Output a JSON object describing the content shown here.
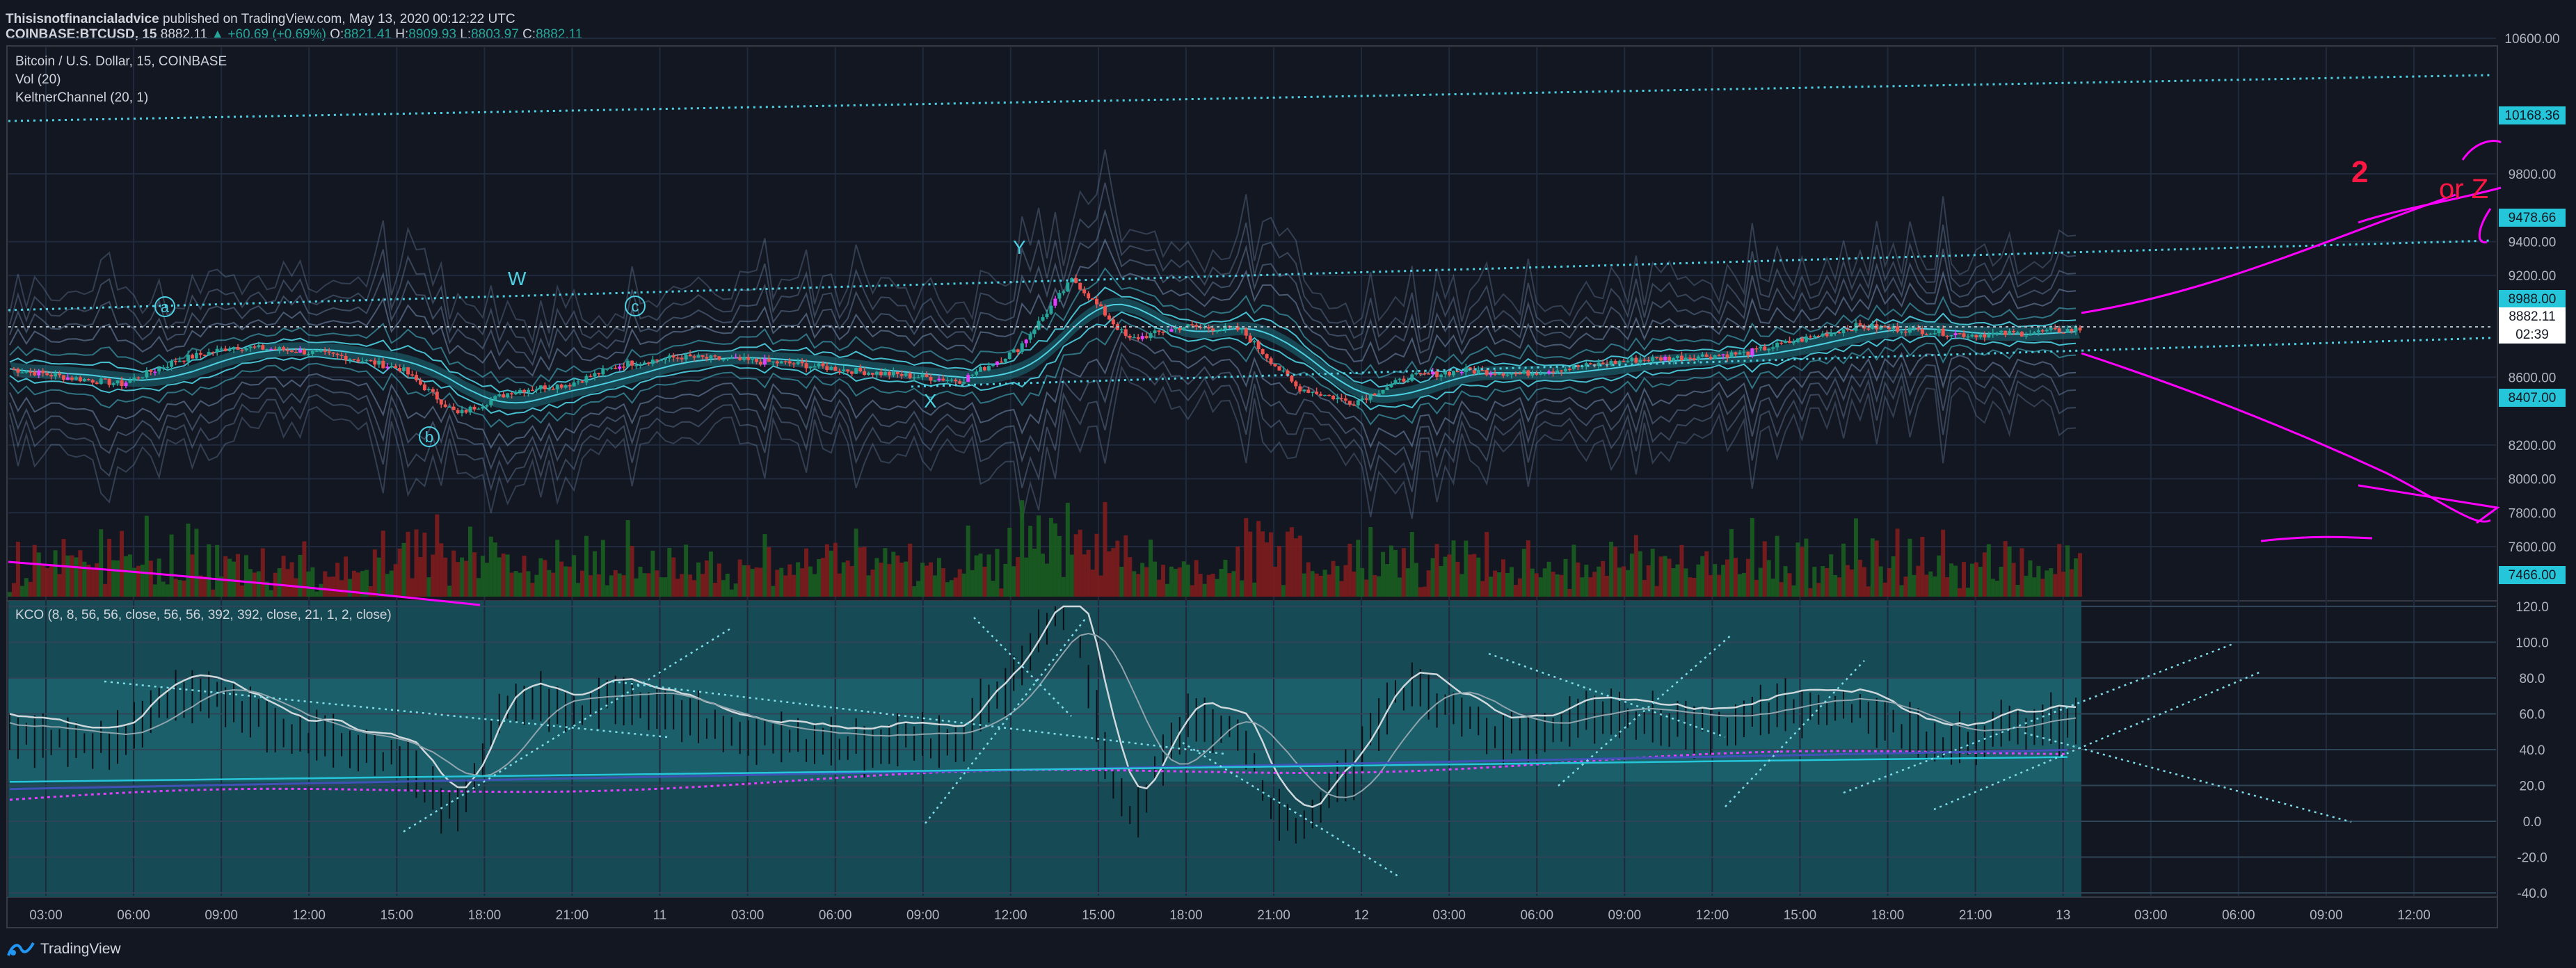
{
  "header": {
    "author": "Thisisnotfinancialadvice",
    "published_text": "published on TradingView.com, May 13, 2020 00:12:22 UTC",
    "symbol": "COINBASE:BTCUSD, 15",
    "last": "8882.11",
    "change": "▲ +60.69 (+0.69%)",
    "o_label": "O:",
    "o_value": "8821.41",
    "h_label": "H:",
    "h_value": "8909.93",
    "l_label": "L:",
    "l_value": "8803.97",
    "c_label": "C:",
    "c_value": "8882.11"
  },
  "legend": {
    "series": "Bitcoin / U.S. Dollar, 15, COINBASE",
    "volume": "Vol (20)",
    "keltner": "KeltnerChannel (20, 1)",
    "kco": "KCO (8, 8, 56, 56, close, 56, 56, 392, 392, close, 21, 1, 2, close)"
  },
  "annotations": {
    "w": "W",
    "y": "Y",
    "x": "X",
    "a": "a",
    "b": "b",
    "c": "c",
    "two": "2",
    "or_z": "or Z"
  },
  "price_labels": {
    "p10168": "10168.36",
    "p9478": "9478.66",
    "p8988": "8988.00",
    "p8882": "8882.11",
    "countdown": "02:39",
    "p8407": "8407.00",
    "p7466": "7466.00"
  },
  "branding": {
    "name": "TradingView"
  },
  "colors": {
    "background": "#131722",
    "up": "#26a69a",
    "down": "#ef5350",
    "channel": "#4dd0e1",
    "magenta": "#ff00ff",
    "red_note": "#ff1744"
  },
  "chart_data": [
    {
      "type": "candlestick",
      "title": "Bitcoin / U.S. Dollar, 15, COINBASE",
      "y_ticks": [
        "10600.00",
        "9800.00",
        "9400.00",
        "9200.00",
        "8600.00",
        "8200.00",
        "8000.00",
        "7800.00",
        "7600.00"
      ],
      "ylim": [
        7350,
        10700
      ],
      "x_ticks": [
        "03:00",
        "06:00",
        "09:00",
        "12:00",
        "15:00",
        "18:00",
        "21:00",
        "11",
        "03:00",
        "06:00",
        "09:00",
        "12:00",
        "15:00",
        "18:00",
        "21:00",
        "12",
        "03:00",
        "06:00",
        "09:00",
        "12:00",
        "15:00",
        "18:00",
        "21:00",
        "13",
        "03:00",
        "06:00",
        "09:00",
        "12:00"
      ],
      "approx_close_path": [
        8650,
        8600,
        8560,
        8700,
        8780,
        8760,
        8720,
        8650,
        8380,
        8520,
        8560,
        8680,
        8720,
        8700,
        8680,
        8640,
        8610,
        8580,
        8760,
        9180,
        8820,
        8900,
        8880,
        8540,
        8450,
        8600,
        8640,
        8620,
        8660,
        8700,
        8720,
        8740,
        8820,
        8900,
        8880,
        8850,
        8860,
        8882.11
      ],
      "volume_label": "Vol (20)"
    },
    {
      "type": "line",
      "title": "KCO (8, 8, 56, 56, close, 56, 56, 392, 392, close, 21, 1, 2, close)",
      "y_ticks": [
        "120.0",
        "100.0",
        "80.0",
        "60.0",
        "40.0",
        "20.0",
        "0.0",
        "-20.0",
        "-40.0"
      ],
      "ylim": [
        -45,
        125
      ]
    }
  ]
}
